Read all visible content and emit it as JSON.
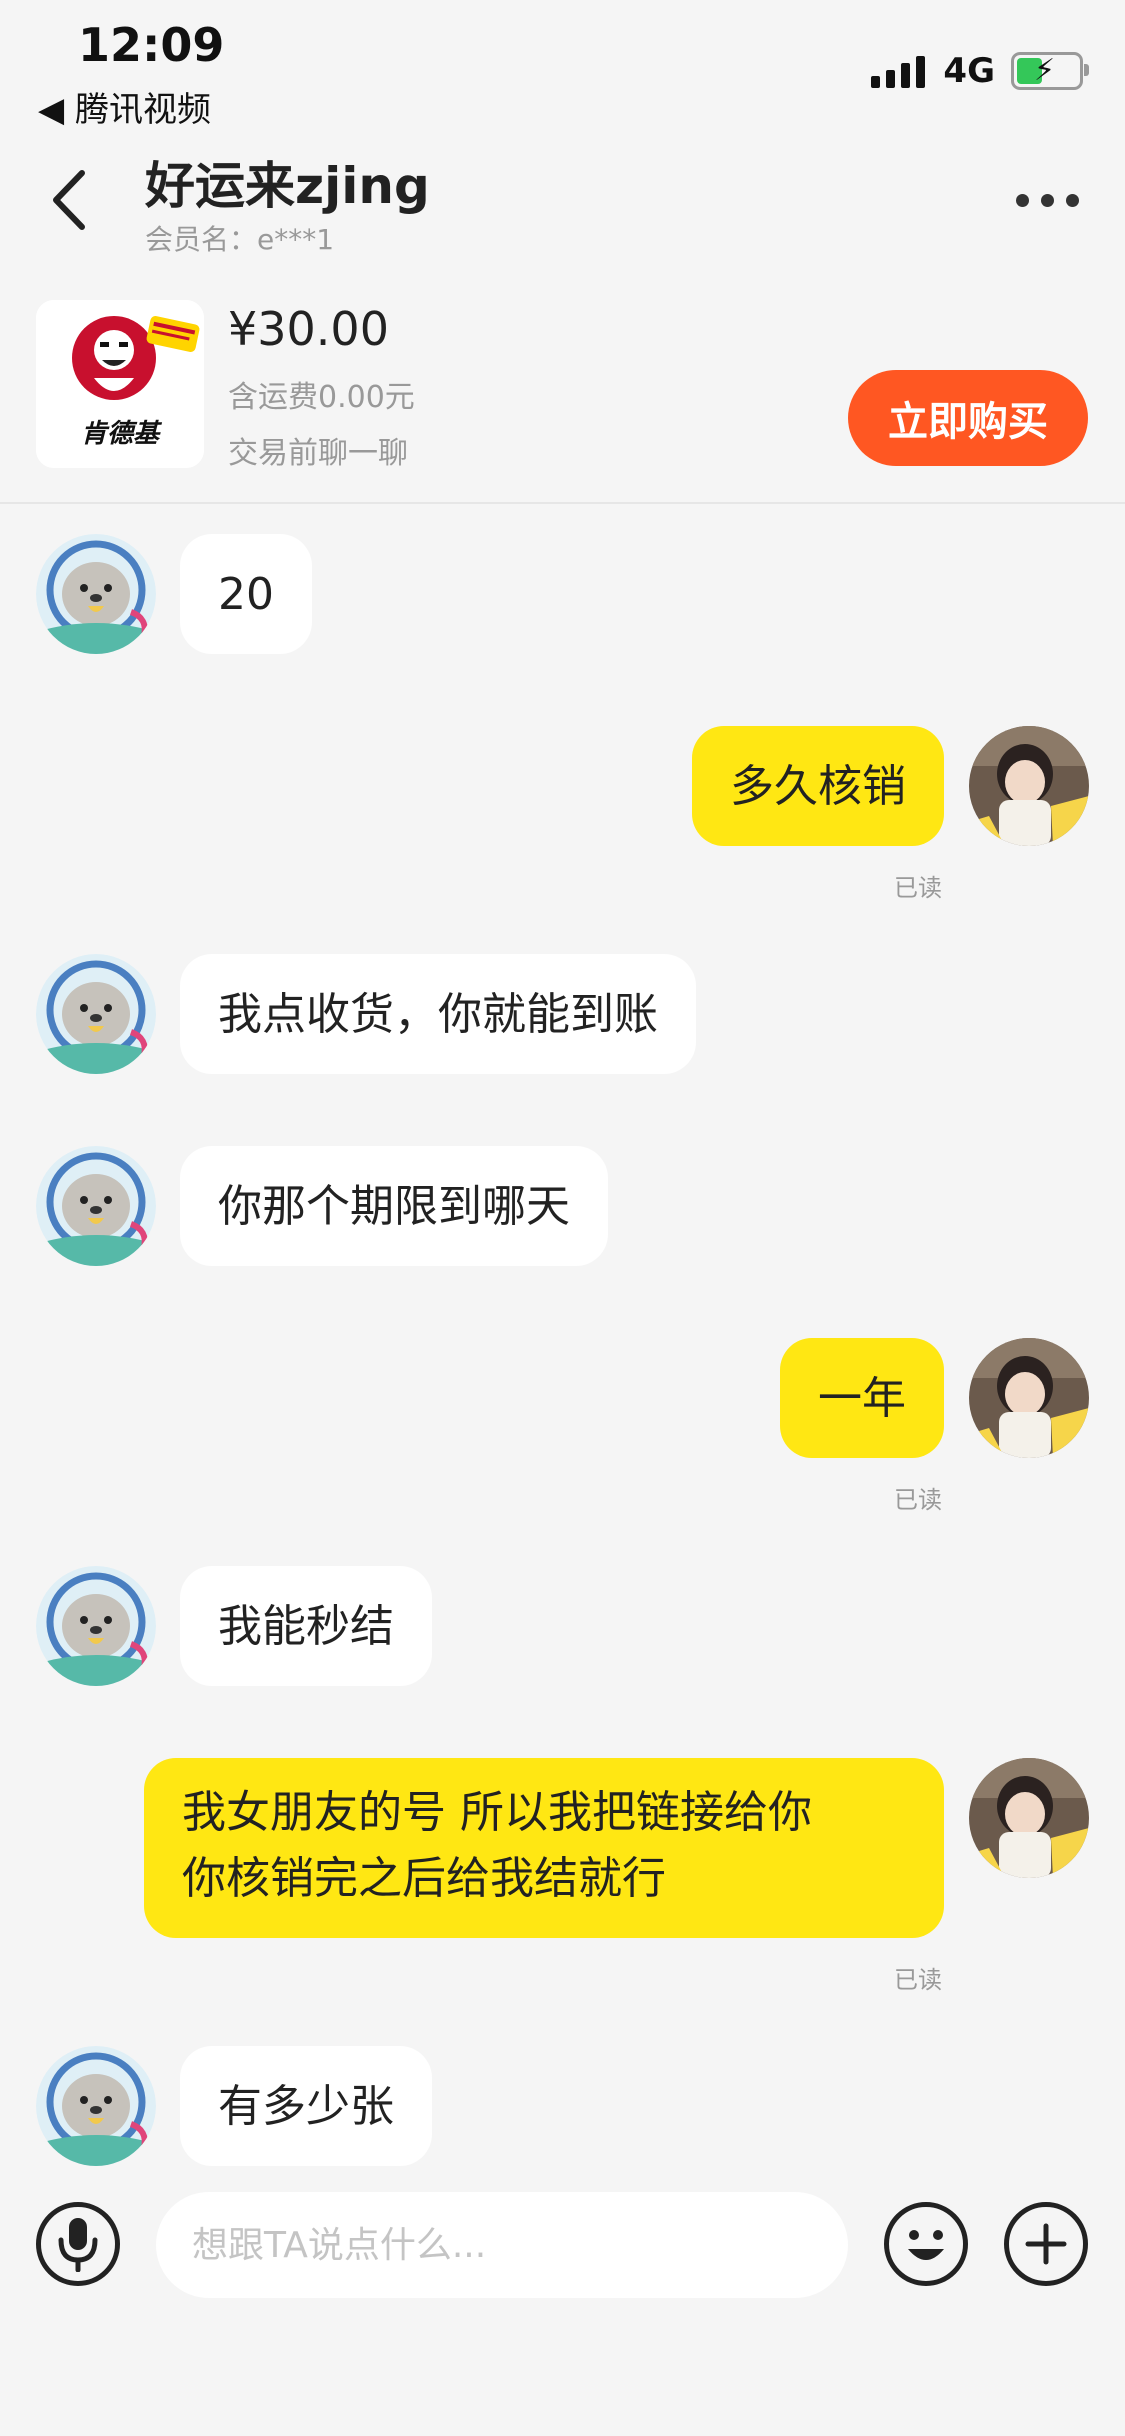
{
  "status_bar": {
    "time": "12:09",
    "back_app_label": "◀ 腾讯视频",
    "network": "4G"
  },
  "header": {
    "back_icon": "chevron-left-icon",
    "title": "好运来zjing",
    "subtitle": "会员名：e***1",
    "more_icon": "more-dots-icon"
  },
  "product": {
    "image_alt": "肯德基",
    "price": "¥30.00",
    "shipping": "含运费0.00元",
    "chat_hint": "交易前聊一聊",
    "buy_label": "立即购买",
    "buy_color": "#ff5722"
  },
  "messages": [
    {
      "side": "left",
      "text": "20"
    },
    {
      "side": "right",
      "text": "多久核销",
      "status": "已读"
    },
    {
      "side": "left",
      "text": "我点收货，你就能到账"
    },
    {
      "side": "left",
      "text": "你那个期限到哪天"
    },
    {
      "side": "right",
      "text": "一年",
      "status": "已读"
    },
    {
      "side": "left",
      "text": "我能秒结"
    },
    {
      "side": "right",
      "lines": [
        "我女朋友的号 所以我把链接给你",
        "你核销完之后给我结就行"
      ],
      "status": "已读"
    },
    {
      "side": "left",
      "text": "有多少张"
    }
  ],
  "input_bar": {
    "placeholder": "想跟TA说点什么...",
    "mic_icon": "microphone-icon",
    "emoji_icon": "emoji-icon",
    "plus_icon": "plus-icon"
  },
  "colors": {
    "my_bubble": "#ffe713",
    "their_bubble": "#ffffff",
    "background": "#f5f5f5"
  }
}
